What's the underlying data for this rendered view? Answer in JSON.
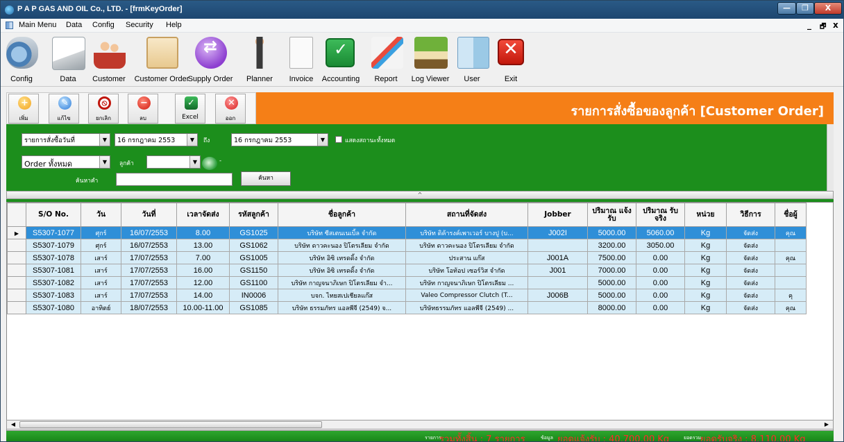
{
  "window": {
    "title": "P A P GAS AND OIL Co., LTD. - [frmKeyOrder]",
    "min": "—",
    "max": "❐",
    "close": "X"
  },
  "menu": {
    "items": [
      "Main Menu",
      "Data",
      "Config",
      "Security",
      "Help"
    ],
    "mdi_min": "_",
    "mdi_restore": "🗗",
    "mdi_close": "x"
  },
  "toolbar": [
    {
      "label": "Config",
      "icon": "config-icon"
    },
    {
      "label": "Data",
      "icon": "data-icon"
    },
    {
      "label": "Customer",
      "icon": "customer-icon"
    },
    {
      "label": "Customer Order",
      "icon": "customer-order-icon"
    },
    {
      "label": "Supply Order",
      "icon": "supply-order-icon"
    },
    {
      "label": "Planner",
      "icon": "planner-icon"
    },
    {
      "label": "Invoice",
      "icon": "invoice-icon"
    },
    {
      "label": "Accounting",
      "icon": "accounting-icon"
    },
    {
      "label": "Report",
      "icon": "report-icon"
    },
    {
      "label": "Log Viewer",
      "icon": "log-viewer-icon"
    },
    {
      "label": "User",
      "icon": "user-icon"
    },
    {
      "label": "Exit",
      "icon": "exit-icon"
    }
  ],
  "order_toolbar": {
    "buttons": [
      {
        "label": "เพิ่ม",
        "icon": "add-icon"
      },
      {
        "label": "แก้ไข",
        "icon": "edit-icon"
      },
      {
        "label": "ยกเลิก",
        "icon": "cancel-icon"
      },
      {
        "label": "ลบ",
        "icon": "delete-icon"
      },
      {
        "label": "Excel",
        "icon": "excel-icon"
      },
      {
        "label": "ออก",
        "icon": "exit-icon"
      }
    ],
    "title": "รายการสั่งซื้อของลูกค้า [Customer  Order]"
  },
  "filter": {
    "date_type": "รายการสั่งซื้อวันที่",
    "date_from": "16 กรกฎาคม   2553",
    "to_label": "ถึง",
    "date_to": "16 กรกฎาคม   2553",
    "show_all_label": "แสดงสถานะทั้งหมด",
    "order_type": "Order ทั้งหมด",
    "customer_label": "ลูกค้า",
    "customer_value": "",
    "dash": "-",
    "search_label": "ค้นหาคำ",
    "search_value": "",
    "search_button": "ค้นหา",
    "collapse": "^"
  },
  "grid": {
    "columns": [
      "S/O No.",
      "วัน",
      "วันที่",
      "เวลาจัดส่ง",
      "รหัสลูกค้า",
      "ชื่อลูกค้า",
      "สถานที่จัดส่ง",
      "Jobber",
      "ปริมาณ แจ้งรับ",
      "ปริมาณ รับจริง",
      "หน่วย",
      "วิธีการ",
      "ชื่อผู้"
    ],
    "rows": [
      [
        "S5307-1077",
        "ศุกร์",
        "16/07/2553",
        "8.00",
        "GS1025",
        "บริษัท ซีสเตนเนเบิ้ล จำกัด",
        "บริษัท ดิค้ารงค์เพาเวอร์ บางปู (บ...",
        "J002I",
        "5000.00",
        "5060.00",
        "Kg",
        "จัดส่ง",
        "คุณ"
      ],
      [
        "S5307-1079",
        "ศุกร์",
        "16/07/2553",
        "13.00",
        "GS1062",
        "บริษัท ดาวคะนอง ปิโตรเลียม จำกัด",
        "บริษัท ดาวคะนอง ปิโตรเลียม จำกัด",
        "",
        "3200.00",
        "3050.00",
        "Kg",
        "จัดส่ง",
        ""
      ],
      [
        "S5307-1078",
        "เสาร์",
        "17/07/2553",
        "7.00",
        "GS1005",
        "บริษัท อิซิ เทรดดิ้ง จำกัด",
        "ประสาน แก๊ส",
        "J001A",
        "7500.00",
        "0.00",
        "Kg",
        "จัดส่ง",
        "คุณ"
      ],
      [
        "S5307-1081",
        "เสาร์",
        "17/07/2553",
        "16.00",
        "GS1150",
        "บริษัท อิซิ เทรดดิ้ง จำกัด",
        "บริษัท โอท้อป เซอร์วิส จำกัด",
        "J001",
        "7000.00",
        "0.00",
        "Kg",
        "จัดส่ง",
        ""
      ],
      [
        "S5307-1082",
        "เสาร์",
        "17/07/2553",
        "12.00",
        "GS1100",
        "บริษัท กาญจนาภิเษก ปิโตรเลียม จำ...",
        "บริษัท กาญจนาภิเษก ปิโตรเลียม ...",
        "",
        "5000.00",
        "0.00",
        "Kg",
        "จัดส่ง",
        ""
      ],
      [
        "S5307-1083",
        "เสาร์",
        "17/07/2553",
        "14.00",
        "IN0006",
        "บจก. ไทยสเปเชียลแก๊ส",
        "Valeo Compressor Clutch (T...",
        "J006B",
        "5000.00",
        "0.00",
        "Kg",
        "จัดส่ง",
        "คุ"
      ],
      [
        "S5307-1080",
        "อาทิตย์",
        "18/07/2553",
        "10.00-11.00",
        "GS1085",
        "บริษัท ธรรมภัทร แอลพีจี (2549) จ...",
        "บริษัทธรรมภัทร แอลพีจี (2549) ...",
        "",
        "8000.00",
        "0.00",
        "Kg",
        "จัดส่ง",
        "คุณ"
      ]
    ],
    "selected_row": 0
  },
  "status": {
    "total_label": "รายการ",
    "total_value": "รวมทั้งสิ้น : 7 รายการ",
    "data_label": "ข้อมูล",
    "notified_value": "ยอดแจ้งรับ : 40,700.00 Kg",
    "sum_label": "ยอดรวม",
    "received_value": "ยอดรับจริง : 8,110.00 Kg"
  },
  "colors": {
    "accent_orange": "#f57f17",
    "panel_green": "#1c8e1c",
    "row_blue": "#d6ecf7",
    "selected_blue": "#2f8fd8",
    "status_red": "#ff2a2a"
  }
}
